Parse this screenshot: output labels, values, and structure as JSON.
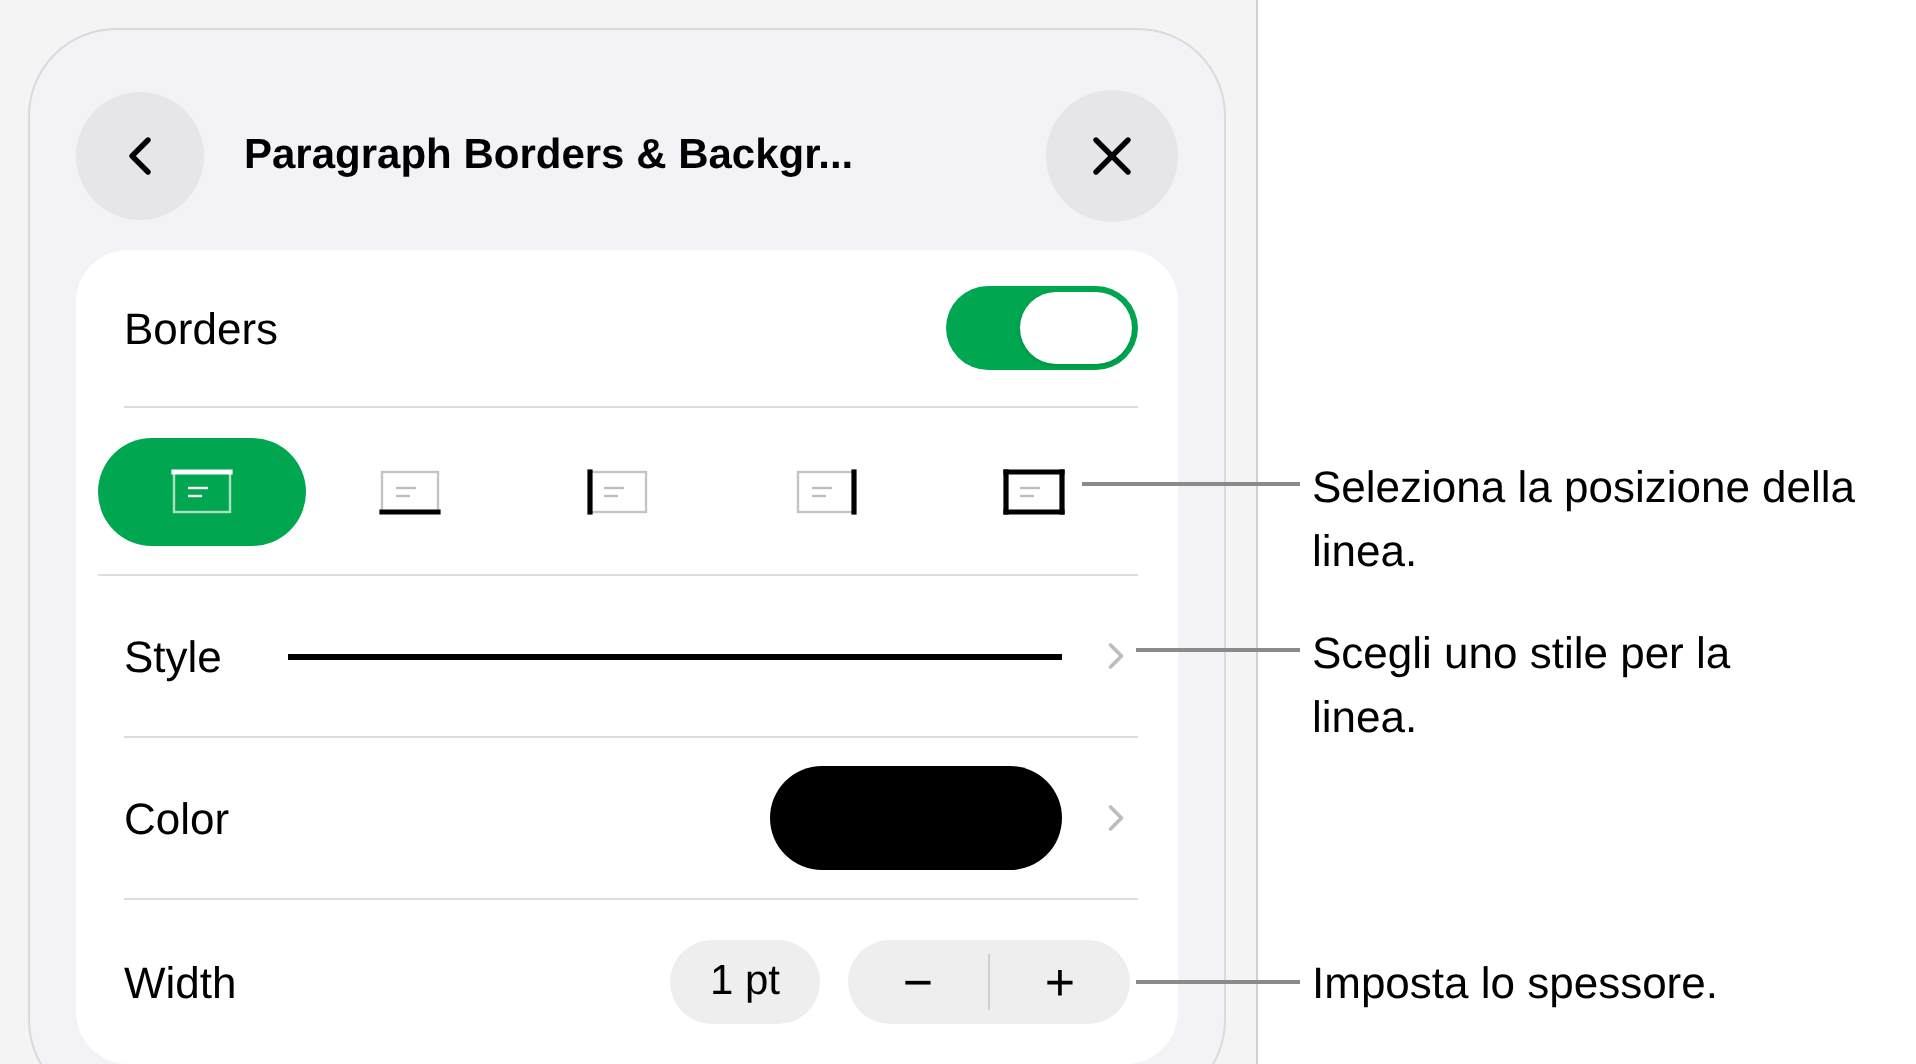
{
  "header": {
    "title": "Paragraph Borders & Backgr..."
  },
  "borders": {
    "label": "Borders",
    "on": true
  },
  "positions": [
    {
      "kind": "top",
      "selected": true
    },
    {
      "kind": "bottom",
      "selected": false
    },
    {
      "kind": "left",
      "selected": false
    },
    {
      "kind": "right",
      "selected": false
    },
    {
      "kind": "all",
      "selected": false
    }
  ],
  "style": {
    "label": "Style"
  },
  "color": {
    "label": "Color",
    "color": "#000000"
  },
  "width": {
    "label": "Width",
    "value": "1 pt",
    "minus": "−",
    "plus": "+"
  },
  "callouts": [
    "Seleziona la posizione della linea.",
    "Scegli uno stile per la linea.",
    "Imposta lo spessore."
  ]
}
